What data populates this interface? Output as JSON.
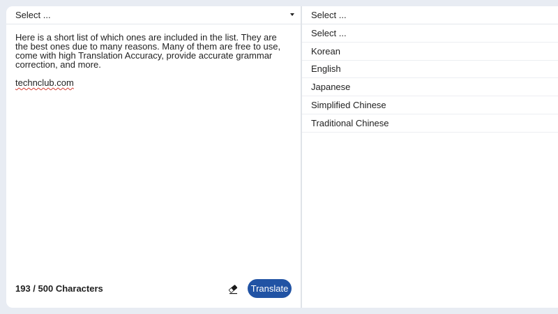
{
  "source": {
    "select_label": "Select ...",
    "text_line1": "Here is a short list of which ones are included in the list. They are the best ones due to many reasons. Many of them are free to use, come with high Translation Accuracy, provide accurate grammar correction, and more.",
    "text_site": "technclub.com",
    "char_count": "193 / 500 Characters",
    "translate_label": "Translate"
  },
  "target": {
    "select_label": "Select ...",
    "options": [
      "Select ...",
      "Korean",
      "English",
      "Japanese",
      "Simplified Chinese",
      "Traditional Chinese"
    ]
  },
  "icons": {
    "caret": "chevron-down-icon",
    "eraser": "eraser-icon"
  },
  "colors": {
    "accent": "#2153a4",
    "background": "#e8ecf3",
    "panel": "#ffffff",
    "spellcheck": "#d43a2f"
  }
}
